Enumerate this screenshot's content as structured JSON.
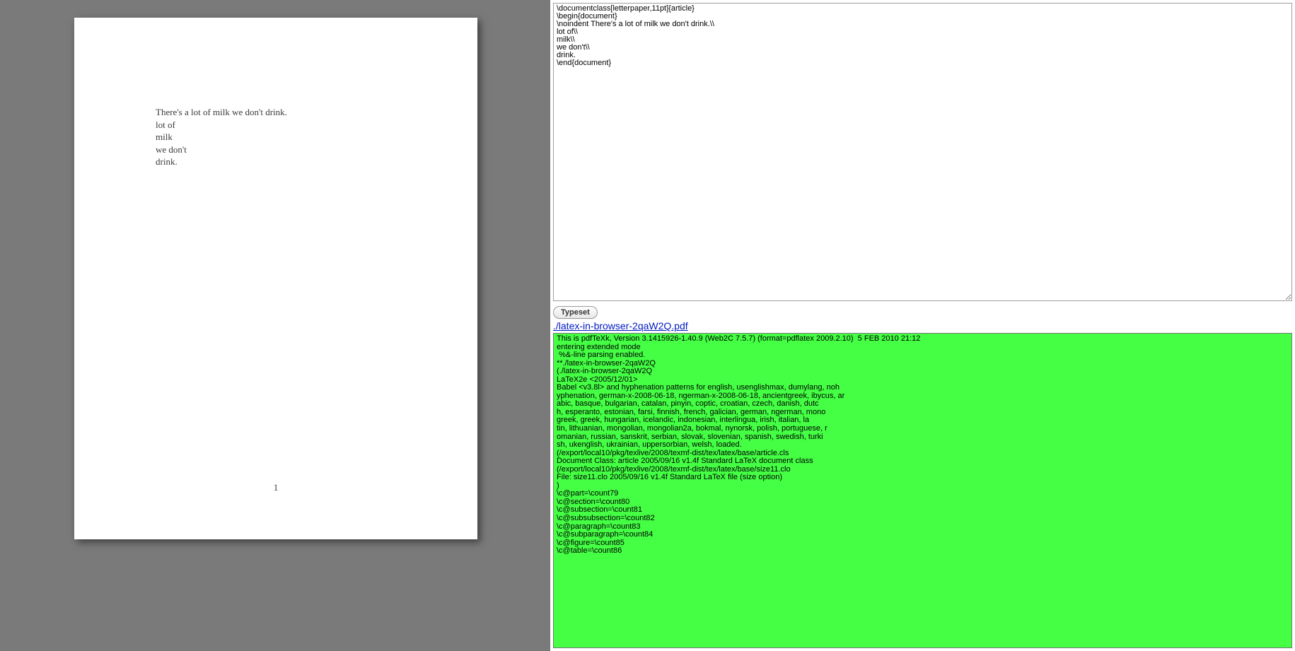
{
  "preview": {
    "lines": [
      "There's a lot of milk we don't drink.",
      "lot of",
      "milk",
      "we don't",
      "drink."
    ],
    "page_number": "1"
  },
  "source": "\\documentclass[letterpaper,11pt]{article}\n\\begin{document}\n\\noindent There's a lot of milk we don't drink.\\\\\nlot of\\\\\nmilk\\\\\nwe don't\\\\\ndrink.\n\\end{document}",
  "controls": {
    "typeset_label": "Typeset",
    "pdf_link_label": "./latex-in-browser-2qaW2Q.pdf"
  },
  "log": "This is pdfTeXk, Version 3.1415926-1.40.9 (Web2C 7.5.7) (format=pdflatex 2009.2.10)  5 FEB 2010 21:12\nentering extended mode\n %&-line parsing enabled.\n**./latex-in-browser-2qaW2Q\n(./latex-in-browser-2qaW2Q\nLaTeX2e <2005/12/01>\nBabel <v3.8l> and hyphenation patterns for english, usenglishmax, dumylang, noh\nyphenation, german-x-2008-06-18, ngerman-x-2008-06-18, ancientgreek, ibycus, ar\nabic, basque, bulgarian, catalan, pinyin, coptic, croatian, czech, danish, dutc\nh, esperanto, estonian, farsi, finnish, french, galician, german, ngerman, mono\ngreek, greek, hungarian, icelandic, indonesian, interlingua, irish, italian, la\ntin, lithuanian, mongolian, mongolian2a, bokmal, nynorsk, polish, portuguese, r\nomanian, russian, sanskrit, serbian, slovak, slovenian, spanish, swedish, turki\nsh, ukenglish, ukrainian, uppersorbian, welsh, loaded.\n(/export/local10/pkg/texlive/2008/texmf-dist/tex/latex/base/article.cls\nDocument Class: article 2005/09/16 v1.4f Standard LaTeX document class\n(/export/local10/pkg/texlive/2008/texmf-dist/tex/latex/base/size11.clo\nFile: size11.clo 2005/09/16 v1.4f Standard LaTeX file (size option)\n)\n\\c@part=\\count79\n\\c@section=\\count80\n\\c@subsection=\\count81\n\\c@subsubsection=\\count82\n\\c@paragraph=\\count83\n\\c@subparagraph=\\count84\n\\c@figure=\\count85\n\\c@table=\\count86\n"
}
